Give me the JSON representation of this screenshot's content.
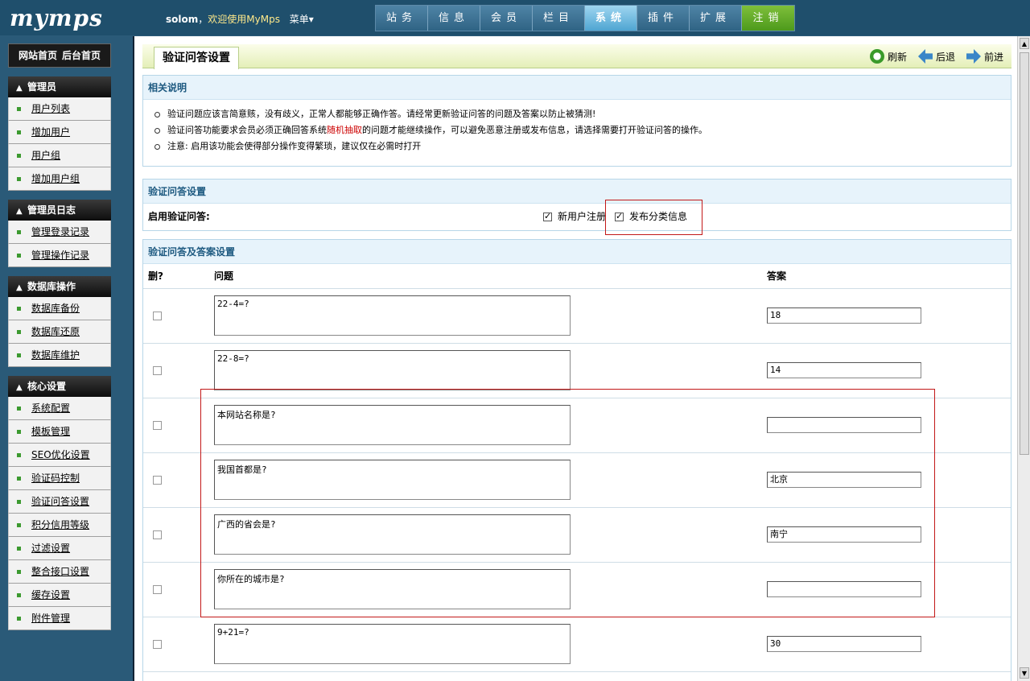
{
  "topbar": {
    "logo": "mymps",
    "user": "solom",
    "comma": "，",
    "welcome": "欢迎使用MyMps",
    "menu": "菜单▾",
    "tabs": [
      "站务",
      "信息",
      "会员",
      "栏目",
      "系统",
      "插件",
      "扩展",
      "注销"
    ],
    "active_tab": "系统"
  },
  "sidebar": {
    "home_site": "网站首页",
    "home_admin": "后台首页",
    "groups": [
      {
        "title": "管理员",
        "items": [
          "用户列表",
          "增加用户",
          "用户组",
          "增加用户组"
        ]
      },
      {
        "title": "管理员日志",
        "items": [
          "管理登录记录",
          "管理操作记录"
        ]
      },
      {
        "title": "数据库操作",
        "items": [
          "数据库备份",
          "数据库还原",
          "数据库维护"
        ]
      },
      {
        "title": "核心设置",
        "items": [
          "系统配置",
          "模板管理",
          "SEO优化设置",
          "验证码控制",
          "验证问答设置",
          "积分信用等级",
          "过滤设置",
          "整合接口设置",
          "缓存设置",
          "附件管理"
        ]
      }
    ]
  },
  "main": {
    "page_title": "验证问答设置",
    "actions": {
      "refresh": "刷新",
      "back": "后退",
      "forward": "前进"
    },
    "notes_box": {
      "title": "相关说明",
      "note1": "验证问题应该言简意赅，没有歧义，正常人都能够正确作答。请经常更新验证问答的问题及答案以防止被猜测!",
      "note2_a": "验证问答功能要求会员必须正确回答系统",
      "note2_red": "随机抽取",
      "note2_b": "的问题才能继续操作，可以避免恶意注册或发布信息，请选择需要打开验证问答的操作。",
      "note3": "注意: 启用该功能会使得部分操作变得繁琐，建议仅在必需时打开"
    },
    "settings_box": {
      "title": "验证问答设置",
      "enable_label": "启用验证问答:",
      "opt_register": "新用户注册",
      "opt_post": "发布分类信息"
    },
    "qa_box": {
      "title": "验证问答及答案设置",
      "col_delete": "删?",
      "col_question": "问题",
      "col_answer": "答案",
      "rows": [
        {
          "q": "22-4=?",
          "a": "18"
        },
        {
          "q": "22-8=?",
          "a": "14"
        },
        {
          "q": "本网站名称是?",
          "a": ""
        },
        {
          "q": "我国首都是?",
          "a": "北京"
        },
        {
          "q": "广西的省会是?",
          "a": "南宁"
        },
        {
          "q": "你所在的城市是?",
          "a": ""
        },
        {
          "q": "9+21=?",
          "a": "30"
        }
      ]
    }
  }
}
